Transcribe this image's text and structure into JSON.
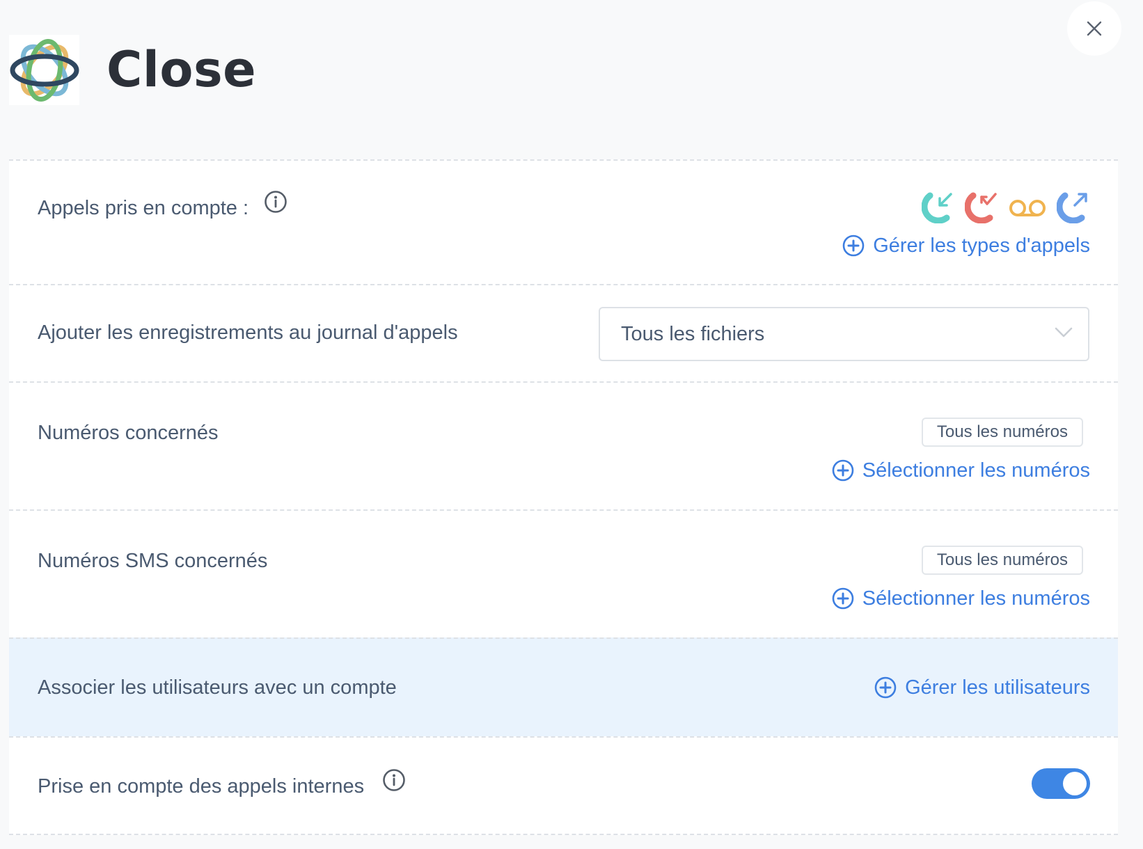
{
  "header": {
    "title": "Close",
    "close_icon": "close-x-icon",
    "logo_icon": "close-logo-icon"
  },
  "rows": {
    "calls_counted": {
      "label": "Appels pris en compte :",
      "call_type_icons": [
        "incoming-call-icon",
        "missed-call-icon",
        "voicemail-icon",
        "outgoing-call-icon"
      ],
      "link": "Gérer les types d'appels"
    },
    "recordings": {
      "label": "Ajouter les enregistrements au journal d'appels",
      "select_value": "Tous les fichiers"
    },
    "numbers": {
      "label": "Numéros concernés",
      "tag": "Tous les numéros",
      "link": "Sélectionner les numéros"
    },
    "sms_numbers": {
      "label": "Numéros SMS concernés",
      "tag": "Tous les numéros",
      "link": "Sélectionner les numéros"
    },
    "users": {
      "label": "Associer les utilisateurs avec un compte",
      "link": "Gérer les utilisateurs"
    },
    "internal_calls": {
      "label": "Prise en compte des appels internes",
      "toggle_on": true
    }
  },
  "colors": {
    "accent": "#3d7ee0",
    "incoming": "#5fd0c8",
    "missed": "#e8716a",
    "voicemail": "#f0b34f",
    "outgoing": "#6a9ee8",
    "highlight_row": "#e9f3fd",
    "toggle_on": "#3e86e4"
  }
}
